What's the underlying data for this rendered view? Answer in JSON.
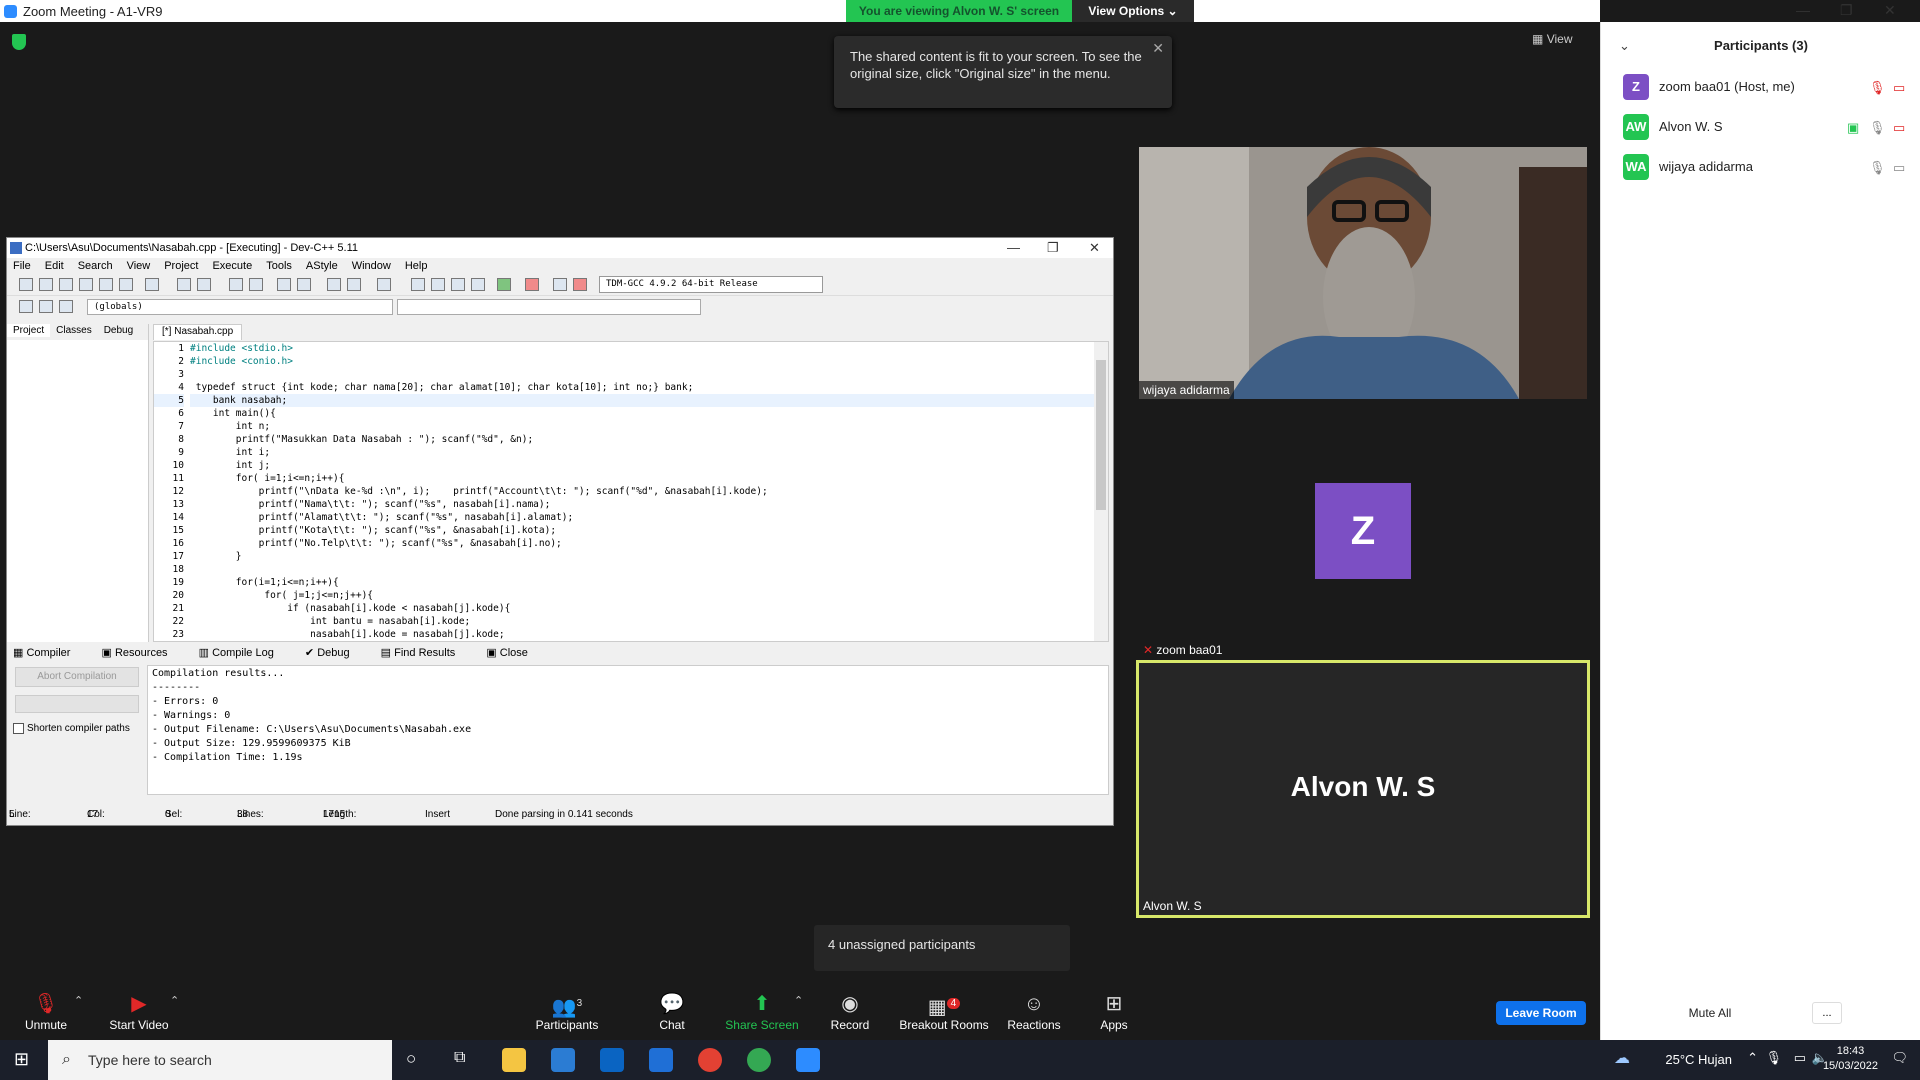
{
  "window": {
    "title": "Zoom Meeting - A1-VR9"
  },
  "banner": {
    "viewing": "You are viewing Alvon W. S' screen",
    "view_options": "View Options"
  },
  "notice": {
    "text": "The shared content is fit to your screen. To see the original size, click \"Original size\" in the menu."
  },
  "gallery": {
    "view_label": "View"
  },
  "devcpp": {
    "title": "C:\\Users\\Asu\\Documents\\Nasabah.cpp - [Executing] - Dev-C++ 5.11",
    "menu": [
      "File",
      "Edit",
      "Search",
      "View",
      "Project",
      "Execute",
      "Tools",
      "AStyle",
      "Window",
      "Help"
    ],
    "compiler": "TDM-GCC 4.9.2 64-bit Release",
    "globals": "(globals)",
    "left_tabs": [
      "Project",
      "Classes",
      "Debug"
    ],
    "file_tab": "[*] Nasabah.cpp",
    "code": [
      "#include <stdio.h>",
      "#include <conio.h>",
      "",
      " typedef struct {int kode; char nama[20]; char alamat[10]; char kota[10]; int no;} bank;",
      "    bank nasabah;",
      "    int main(){",
      "        int n;",
      "        printf(\"Masukkan Data Nasabah : \"); scanf(\"%d\", &n);",
      "        int i;",
      "        int j;",
      "        for( i=1;i<=n;i++){",
      "            printf(\"\\nData ke-%d :\\n\", i);    printf(\"Account\\t\\t: \"); scanf(\"%d\", &nasabah[i].kode);",
      "            printf(\"Nama\\t\\t: \"); scanf(\"%s\", nasabah[i].nama);",
      "            printf(\"Alamat\\t\\t: \"); scanf(\"%s\", nasabah[i].alamat);",
      "            printf(\"Kota\\t\\t: \"); scanf(\"%s\", &nasabah[i].kota);",
      "            printf(\"No.Telp\\t\\t: \"); scanf(\"%s\", &nasabah[i].no);",
      "        }",
      "",
      "        for(i=1;i<=n;i++){",
      "             for( j=1;j<=n;j++){",
      "                 if (nasabah[i].kode < nasabah[j].kode){",
      "                     int bantu = nasabah[i].kode;",
      "                     nasabah[i].kode = nasabah[j].kode;"
    ],
    "line_numbers": [
      "1",
      "2",
      "3",
      "4",
      "5",
      "6",
      "7",
      "8",
      "9",
      "10",
      "11",
      "12",
      "13",
      "14",
      "15",
      "16",
      "17",
      "18",
      "19",
      "20",
      "21",
      "22",
      "23"
    ],
    "bottom_tabs": [
      "Compiler",
      "Resources",
      "Compile Log",
      "Debug",
      "Find Results",
      "Close"
    ],
    "abort_label": "Abort Compilation",
    "shorten_label": "Shorten compiler paths",
    "log": "Compilation results...\n--------\n- Errors: 0\n- Warnings: 0\n- Output Filename: C:\\Users\\Asu\\Documents\\Nasabah.exe\n- Output Size: 129.9599609375 KiB\n- Compilation Time: 1.19s",
    "status": {
      "line_label": "Line:",
      "line": "5",
      "col_label": "Col:",
      "col": "17",
      "sel_label": "Sel:",
      "sel": "0",
      "lines_label": "Lines:",
      "lines": "38",
      "length_label": "Length:",
      "length": "1715",
      "mode": "Insert",
      "parse": "Done parsing in 0.141 seconds"
    }
  },
  "tiles": {
    "wijaya": "wijaya adidarma",
    "zoom": "zoom baa01",
    "avatar_letter": "Z",
    "alvon_center": "Alvon W. S",
    "alvon_tag": "Alvon W. S"
  },
  "unassigned": "4 unassigned participants",
  "panel": {
    "title": "Participants (3)",
    "participants": [
      {
        "initials": "Z",
        "name": "zoom baa01 (Host, me)",
        "color": "#7c4fc4"
      },
      {
        "initials": "AW",
        "name": "Alvon W. S",
        "color": "#23c552"
      },
      {
        "initials": "WA",
        "name": "wijaya adidarma",
        "color": "#23c552"
      }
    ],
    "mute_all": "Mute All",
    "more": "..."
  },
  "toolbar": {
    "unmute": "Unmute",
    "start_video": "Start Video",
    "participants": "Participants",
    "participants_count": "3",
    "chat": "Chat",
    "share": "Share Screen",
    "record": "Record",
    "breakout": "Breakout Rooms",
    "breakout_badge": "4",
    "reactions": "Reactions",
    "apps": "Apps",
    "leave": "Leave Room"
  },
  "taskbar": {
    "search_placeholder": "Type here to search",
    "weather": "25°C  Hujan",
    "time": "18:43",
    "date": "15/03/2022"
  }
}
